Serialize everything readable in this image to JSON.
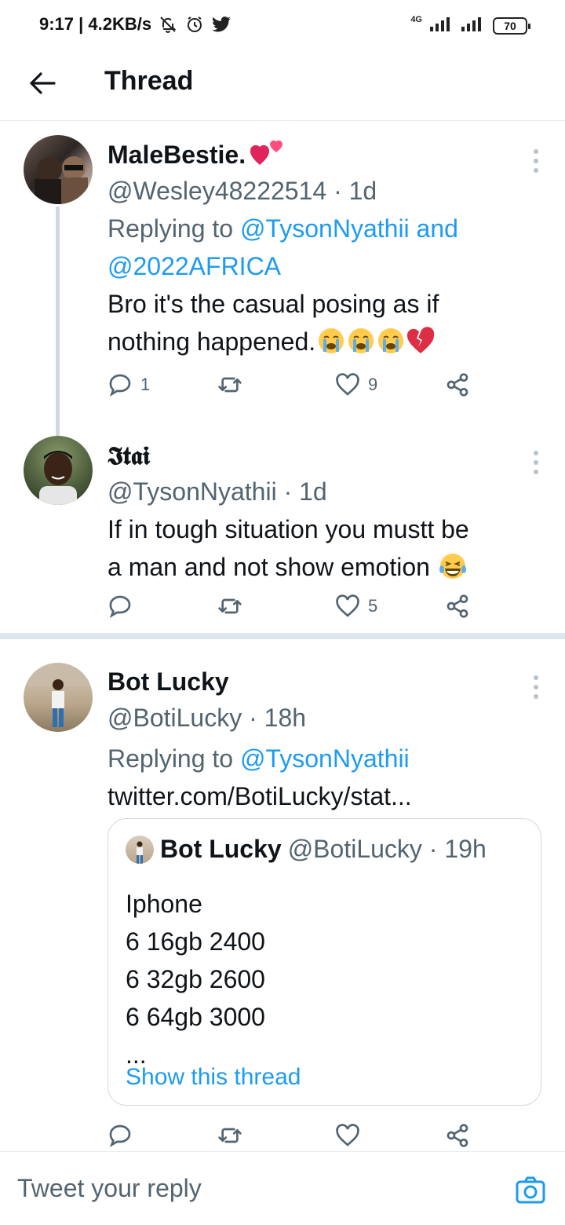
{
  "status_bar": {
    "time_speed": "9:17 | 4.2KB/s",
    "network": "4G",
    "battery": "70"
  },
  "header": {
    "title": "Thread"
  },
  "tweets": [
    {
      "name": "MaleBestie.",
      "handle_time": "@Wesley48222514 · 1d",
      "replying_prefix": "Replying to ",
      "replying_mentions": [
        "@TysonNyathii",
        "and",
        "@2022AFRICA"
      ],
      "text_line1": "Bro it's the casual posing as if",
      "text_line2": "nothing happened.",
      "reply_count": "1",
      "retweet_count": "",
      "like_count": "9"
    },
    {
      "name": "𝕴𝖙𝖆𝖎",
      "handle_time": "@TysonNyathii · 1d",
      "text_line1": "If in tough situation you mustt be",
      "text_line2": "a man and not show emotion",
      "reply_count": "",
      "retweet_count": "",
      "like_count": "5"
    },
    {
      "name": "Bot Lucky",
      "handle_time": "@BotiLucky · 18h",
      "replying_prefix": "Replying to ",
      "replying_mention": "@TysonNyathii",
      "link": "twitter.com/BotiLucky/stat...",
      "quote": {
        "name": "Bot Lucky",
        "handle_time": "@BotiLucky · 19h",
        "lines": [
          "Iphone",
          "6 16gb 2400",
          "6 32gb 2600",
          "6 64gb 3000",
          "..."
        ],
        "show_thread": "Show this thread"
      },
      "reply_count": "",
      "retweet_count": "",
      "like_count": ""
    }
  ],
  "reply_bar": {
    "placeholder": "Tweet your reply"
  },
  "colors": {
    "accent": "#1d9bf0",
    "secondary_text": "#536471",
    "primary_text": "#0f1419",
    "divider": "#dfe6eb"
  }
}
